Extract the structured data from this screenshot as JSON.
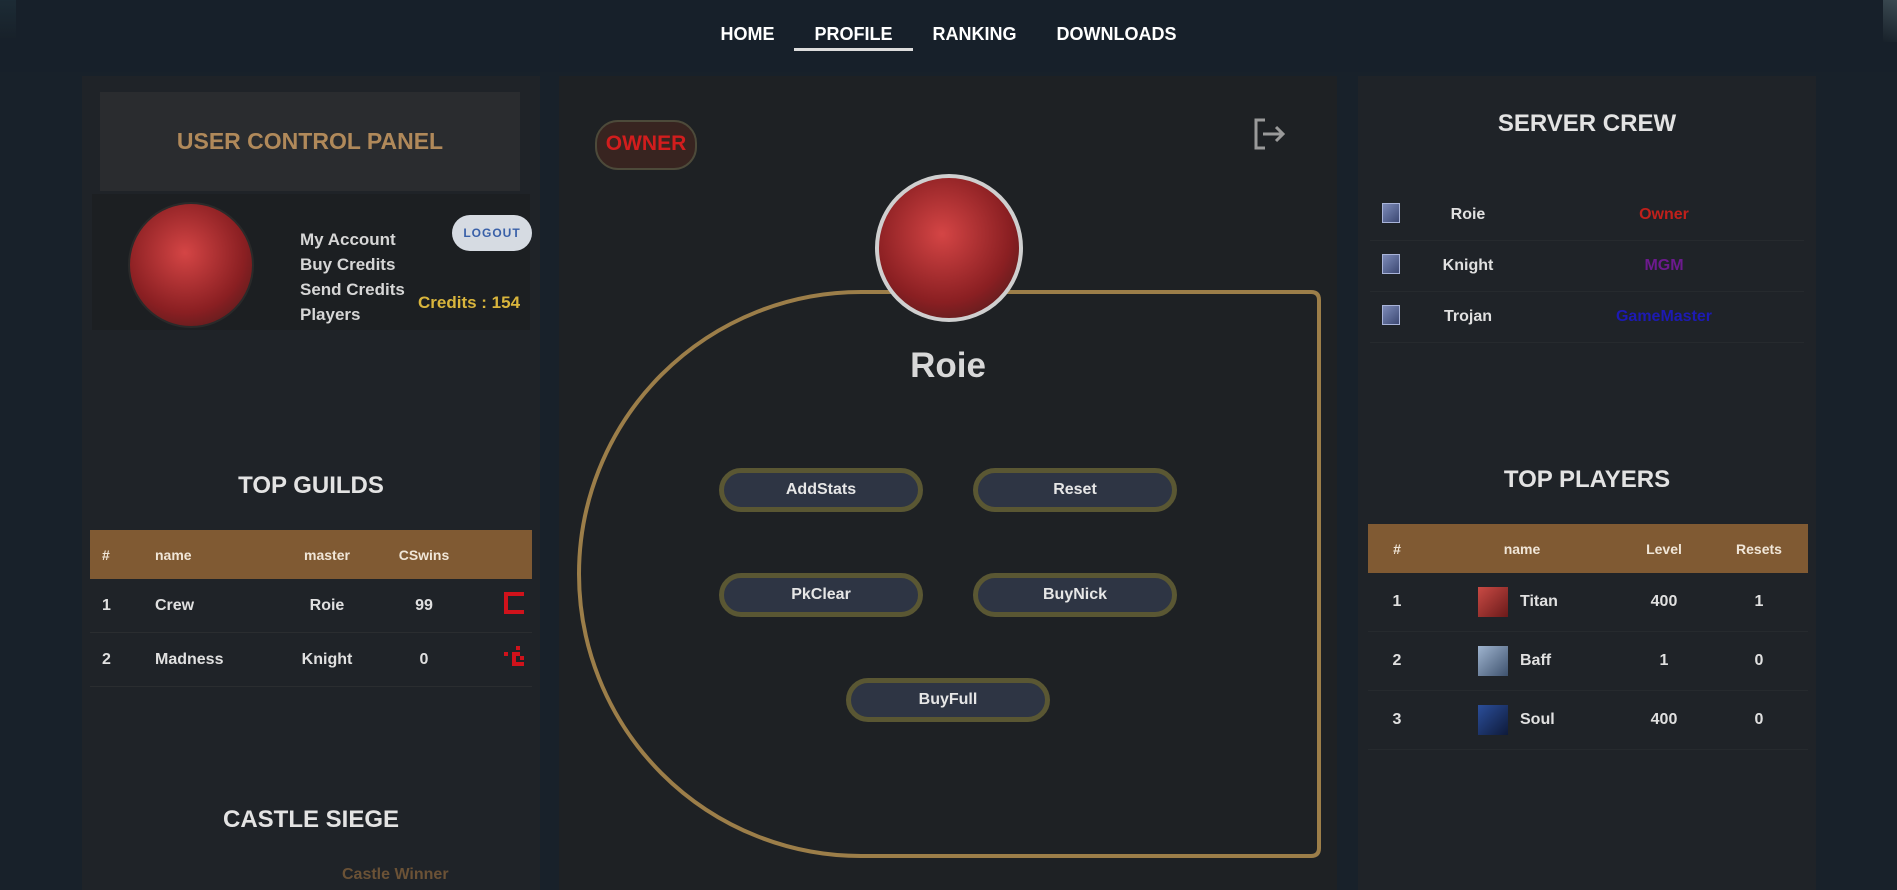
{
  "nav": {
    "items": [
      {
        "label": "HOME"
      },
      {
        "label": "PROFILE"
      },
      {
        "label": "RANKING"
      },
      {
        "label": "DOWNLOADS"
      }
    ],
    "active": "PROFILE"
  },
  "user_panel": {
    "title": "USER CONTROL PANEL",
    "links": [
      "My Account",
      "Buy Credits",
      "Send Credits",
      "Players"
    ],
    "logout_label": "LOGOUT",
    "credits_text": "Credits : 154"
  },
  "top_guilds": {
    "title": "TOP GUILDS",
    "columns": [
      "#",
      "name",
      "master",
      "CSwins",
      ""
    ],
    "rows": [
      {
        "rank": "1",
        "name": "Crew",
        "master": "Roie",
        "cswins": "99"
      },
      {
        "rank": "2",
        "name": "Madness",
        "master": "Knight",
        "cswins": "0"
      }
    ]
  },
  "castle_siege": {
    "title": "CASTLE SIEGE",
    "winner_label": "Castle Winner"
  },
  "profile": {
    "badge": "OWNER",
    "name": "Roie",
    "buttons": [
      "AddStats",
      "Reset",
      "PkClear",
      "BuyNick",
      "BuyFull"
    ]
  },
  "server_crew": {
    "title": "SERVER CREW",
    "members": [
      {
        "name": "Roie",
        "role": "Owner",
        "color": "#c0201b"
      },
      {
        "name": "Knight",
        "role": "MGM",
        "color": "#6d1a8e"
      },
      {
        "name": "Trojan",
        "role": "GameMaster",
        "color": "#1d1ab3"
      }
    ]
  },
  "top_players": {
    "title": "TOP PLAYERS",
    "columns": [
      "#",
      "name",
      "Level",
      "Resets"
    ],
    "rows": [
      {
        "rank": "1",
        "name": "Titan",
        "level": "400",
        "resets": "1"
      },
      {
        "rank": "2",
        "name": "Baff",
        "level": "1",
        "resets": "0"
      },
      {
        "rank": "3",
        "name": "Soul",
        "level": "400",
        "resets": "0"
      }
    ]
  },
  "colors": {
    "accent_gold": "#b0895a",
    "table_header": "#805a33",
    "credits": "#d9b53c",
    "owner_red": "#d21d1d"
  }
}
